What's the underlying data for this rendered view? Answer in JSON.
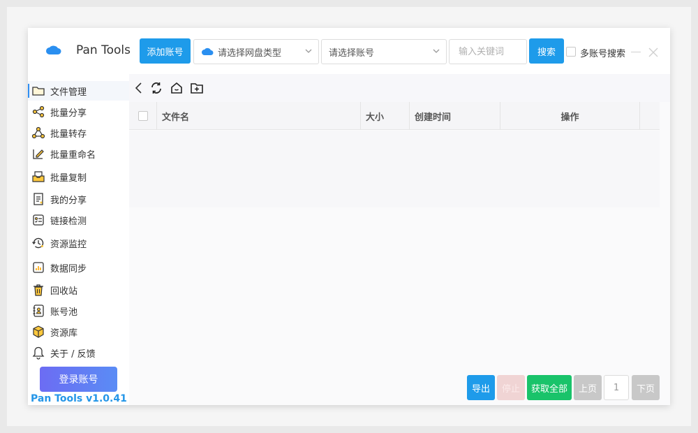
{
  "app": {
    "title": "Pan Tools",
    "version": "Pan Tools v1.0.41"
  },
  "header": {
    "add_account_label": "添加账号",
    "disk_type_placeholder": "请选择网盘类型",
    "account_placeholder": "请选择账号",
    "keyword_placeholder": "输入关键词",
    "search_label": "搜索",
    "multi_account_search_label": "多账号搜索"
  },
  "sidebar": {
    "items": [
      {
        "label": "文件管理",
        "icon": "folder-icon"
      },
      {
        "label": "批量分享",
        "icon": "share-icon"
      },
      {
        "label": "批量转存",
        "icon": "transfer-icon"
      },
      {
        "label": "批量重命名",
        "icon": "rename-icon"
      },
      {
        "label": "批量复制",
        "icon": "copy-icon"
      },
      {
        "label": "我的分享",
        "icon": "my-share-icon"
      },
      {
        "label": "链接检测",
        "icon": "link-check-icon"
      },
      {
        "label": "资源监控",
        "icon": "monitor-icon"
      },
      {
        "label": "数据同步",
        "icon": "sync-chart-icon"
      },
      {
        "label": "回收站",
        "icon": "trash-icon"
      },
      {
        "label": "账号池",
        "icon": "account-pool-icon"
      },
      {
        "label": "资源库",
        "icon": "box-icon"
      },
      {
        "label": "关于 / 反馈",
        "icon": "bell-icon"
      }
    ],
    "login_label": "登录账号"
  },
  "table": {
    "columns": [
      "文件名",
      "大小",
      "创建时间",
      "操作"
    ]
  },
  "pager": {
    "export_label": "导出",
    "stop_label": "停止",
    "get_all_label": "获取全部",
    "prev_label": "上页",
    "page": "1",
    "next_label": "下页"
  },
  "colors": {
    "accent": "#1e9bea",
    "success": "#19c36a",
    "version_text": "#2496e8"
  }
}
